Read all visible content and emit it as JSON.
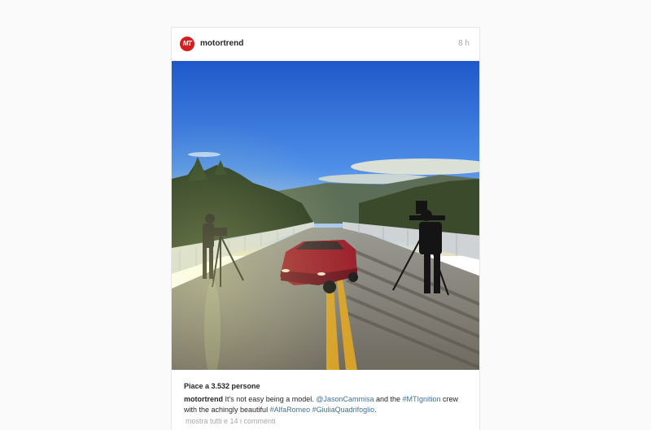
{
  "post": {
    "avatar_text": "MT",
    "username": "motortrend",
    "time": "8 h",
    "image_alt": "Red sedan on a bridge at sunset with two camera operators filming",
    "likes": "Piace a 3.532 persone",
    "caption": {
      "user": "motortrend",
      "text1": " It's not easy being a model. ",
      "mention": "@JasonCammisa",
      "text2": " and the ",
      "hashtag1": "#MTIgnition",
      "text3": " crew with the achingly beautiful ",
      "hashtag2": "#AlfaRomeo",
      "text4": " ",
      "hashtag3": "#GiuliaQuadrifoglio",
      "text5": "."
    },
    "view_comments": "mostra tutti e 14 i commenti"
  },
  "colors": {
    "link": "#3f729b",
    "avatar": "#d21f1f"
  }
}
